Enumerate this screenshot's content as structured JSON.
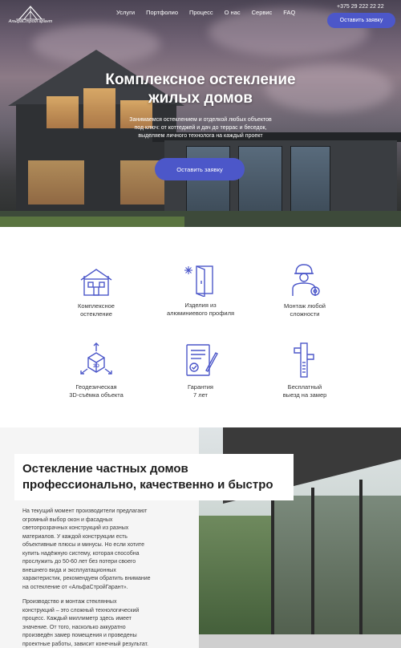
{
  "brand": {
    "logo_text": "АльфаСтройГарант"
  },
  "nav": {
    "items": [
      "Услуги",
      "Портфолио",
      "Процесс",
      "О нас",
      "Сервис",
      "FAQ"
    ]
  },
  "header": {
    "phone": "+375 29 222 22 22",
    "cta_label": "Оставить заявку"
  },
  "hero": {
    "title_line1": "Комплексное остекление",
    "title_line2": "жилых домов",
    "subtitle_line1": "Занимаемся остеклением и отделкой любых объектов",
    "subtitle_line2": "под ключ: от коттеджей и дач до террас и беседок,",
    "subtitle_line3": "выделяем личного технолога на каждый проект",
    "cta_label": "Оставить заявку"
  },
  "services": [
    {
      "icon": "house-icon",
      "line1": "Комплексное",
      "line2": "остекление"
    },
    {
      "icon": "aluminum-door-icon",
      "line1": "Изделия из",
      "line2": "алюминиевого профиля"
    },
    {
      "icon": "installer-icon",
      "line1": "Монтаж любой",
      "line2": "сложности"
    },
    {
      "icon": "cube-3d-icon",
      "line1": "Геодезическая",
      "line2": "3D-съёмка объекта"
    },
    {
      "icon": "certificate-icon",
      "line1": "Гарантия",
      "line2": "7 лет"
    },
    {
      "icon": "caliper-icon",
      "line1": "Бесплатный",
      "line2": "выезд на замер"
    }
  ],
  "section": {
    "title_line1": "Остекление частных домов",
    "title_line2": "профессионально, качественно и быстро",
    "p1": [
      "На текущий момент производители предлагают",
      "огромный выбор окон и фасадных",
      "светопрозрачных конструкций из разных",
      "материалов. У каждой конструкции есть",
      "объективные плюсы и минусы. Но если хотите",
      "купить надёжную систему, которая способна",
      "прослужить до 50-60 лет без потери своего",
      "внешнего вида и эксплуатационных",
      "характеристик, рекомендуем обратить внимание",
      "на остекление от «АльфаСтройГарант»."
    ],
    "p2": [
      "Производство и монтаж стеклянных",
      "конструкций – это сложный технологический",
      "процесс. Каждый миллиметр здесь имеет",
      "значение. От того, насколько аккуратно",
      "произведён замер помещения и проведены",
      "проектные работы, зависит конечный результат."
    ]
  },
  "colors": {
    "accent": "#4c57c9",
    "icon_stroke": "#4c57c9",
    "text": "#1e1e1e"
  }
}
